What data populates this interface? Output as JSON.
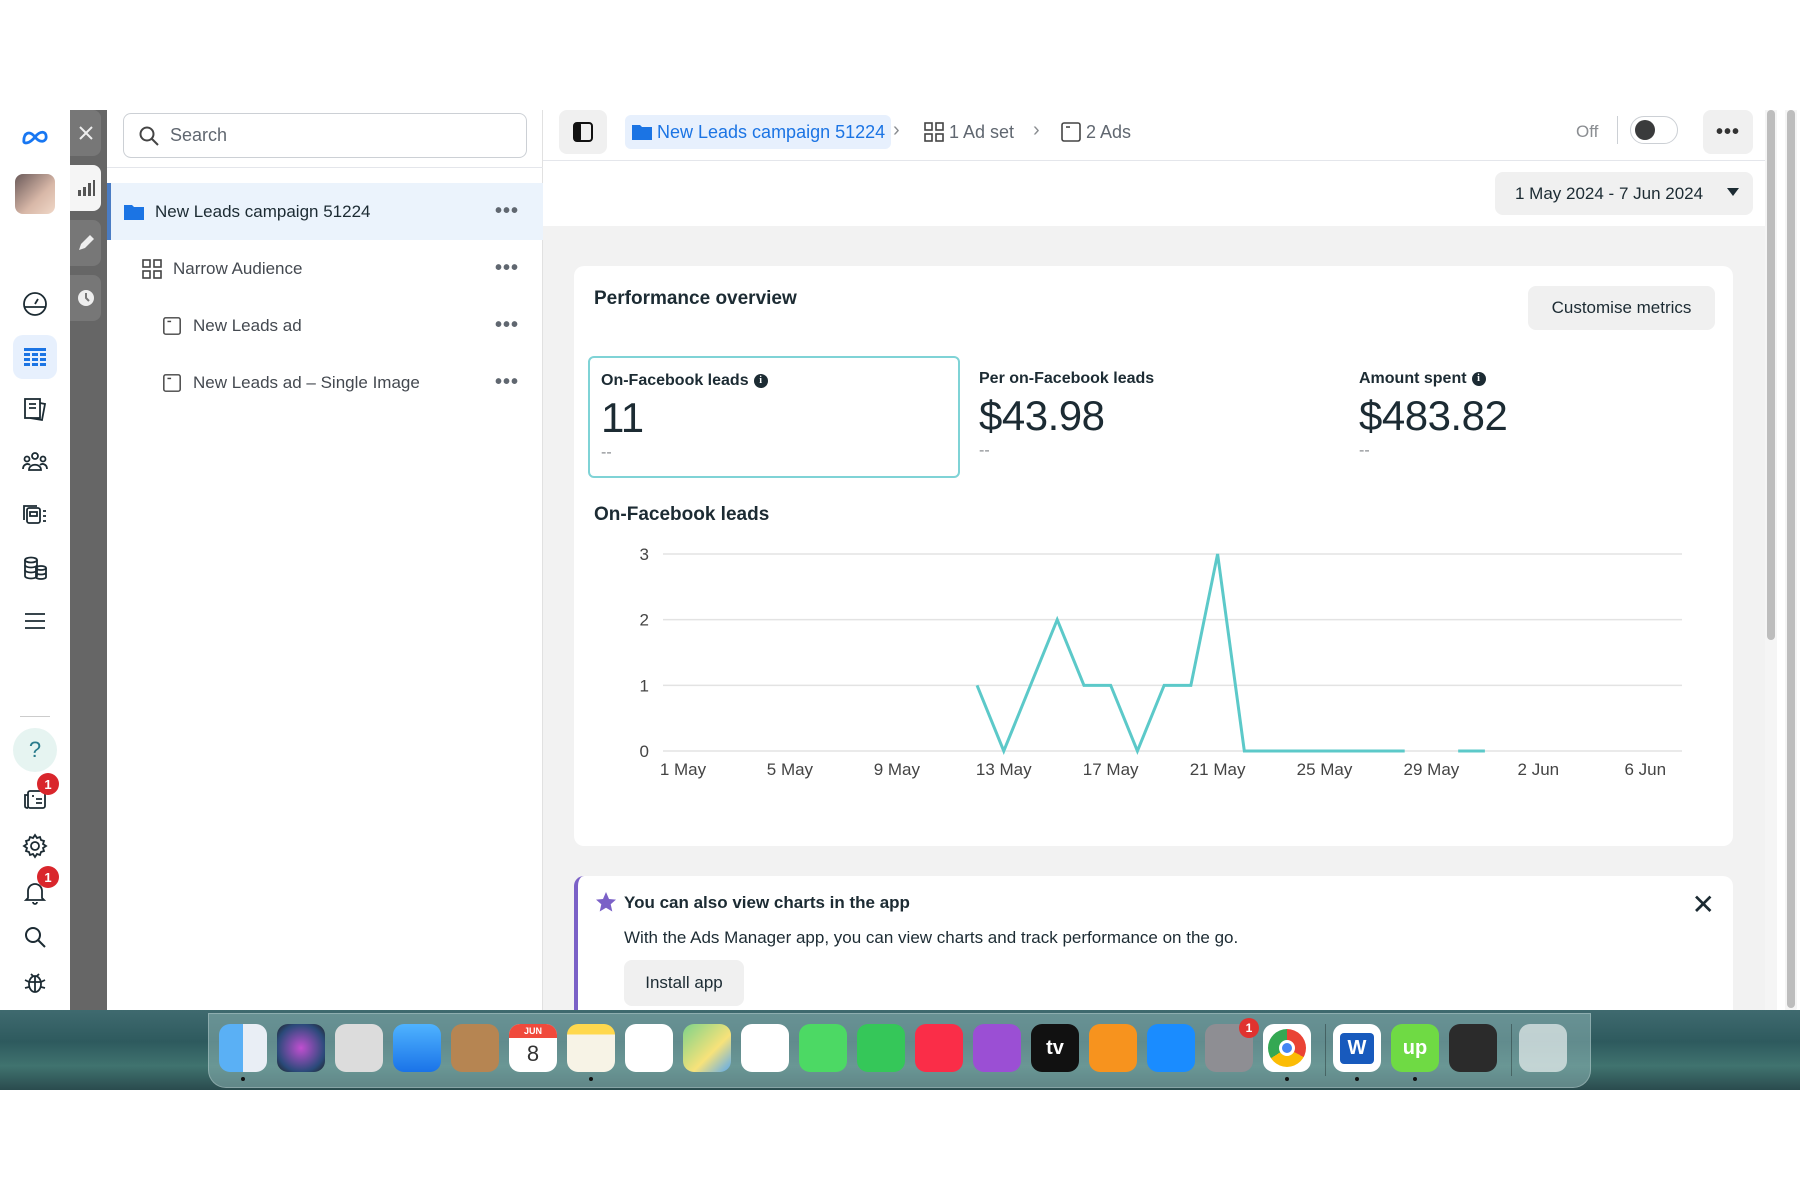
{
  "rail": {
    "icons": [
      {
        "name": "meta-logo-icon"
      },
      {
        "name": "account-avatar"
      },
      {
        "name": "dashboard-gauge-icon"
      },
      {
        "name": "ads-manager-table-icon",
        "active": true
      },
      {
        "name": "pages-icon"
      },
      {
        "name": "audiences-icon"
      },
      {
        "name": "creative-hub-icon"
      },
      {
        "name": "billing-icon"
      },
      {
        "name": "all-tools-menu-icon"
      },
      {
        "name": "help-icon"
      },
      {
        "name": "news-icon",
        "badge": "1"
      },
      {
        "name": "settings-icon"
      },
      {
        "name": "notifications-icon",
        "badge": "1"
      },
      {
        "name": "search-icon"
      },
      {
        "name": "report-bug-icon"
      }
    ]
  },
  "strip": {
    "buttons": [
      "close",
      "charts",
      "edit",
      "history"
    ]
  },
  "tree": {
    "search_placeholder": "Search",
    "rows": [
      {
        "label": "New Leads campaign 51224",
        "type": "campaign",
        "selected": true
      },
      {
        "label": "Narrow Audience",
        "type": "ad-set"
      },
      {
        "label": "New Leads ad",
        "type": "ad"
      },
      {
        "label": "New Leads ad – Single Image",
        "type": "ad"
      }
    ],
    "more_label": "•••"
  },
  "topbar": {
    "breadcrumbs": [
      {
        "label": "New Leads campaign 51224",
        "icon": "folder-icon"
      },
      {
        "label": "1 Ad set",
        "icon": "ad-set-grid-icon"
      },
      {
        "label": "2 Ads",
        "icon": "ad-icon"
      }
    ],
    "status_label": "Off",
    "toggle_on": false,
    "more_label": "•••"
  },
  "date_range": "1 May 2024 - 7 Jun 2024",
  "performance": {
    "title": "Performance overview",
    "customise_label": "Customise metrics",
    "metrics": [
      {
        "label": "On-Facebook leads",
        "value": "11",
        "comparison": "--",
        "info": true,
        "selected": true
      },
      {
        "label": "Per on-Facebook leads",
        "value": "$43.98",
        "comparison": "--",
        "info": false
      },
      {
        "label": "Amount spent",
        "value": "$483.82",
        "comparison": "--",
        "info": true
      }
    ],
    "chart_title": "On-Facebook leads"
  },
  "chart_data": {
    "type": "line",
    "title": "On-Facebook leads",
    "xlabel": "",
    "ylabel": "",
    "ylim": [
      0,
      3
    ],
    "yticks": [
      "0",
      "1",
      "2",
      "3"
    ],
    "xticks": [
      "1 May",
      "5 May",
      "9 May",
      "13 May",
      "17 May",
      "21 May",
      "25 May",
      "29 May",
      "2 Jun",
      "6 Jun"
    ],
    "x_days_start": "1 May",
    "x_days_total": 38,
    "grid": true,
    "color": "#5cc9c9",
    "series": [
      {
        "name": "On-Facebook leads",
        "segments": [
          {
            "start_day_index": 11,
            "values": [
              1,
              0,
              1,
              2,
              1,
              1,
              0,
              1,
              1,
              3,
              0,
              0,
              0,
              0,
              0,
              0,
              0
            ]
          },
          {
            "start_day_index": 29,
            "values": [
              0,
              0
            ]
          }
        ]
      }
    ]
  },
  "banner": {
    "title": "You can also view charts in the app",
    "body": "With the Ads Manager app, you can view charts and track performance on the go.",
    "button_label": "Install app",
    "close_label": "✕"
  },
  "dock": {
    "apps": [
      {
        "name": "Finder",
        "running": true
      },
      {
        "name": "Siri"
      },
      {
        "name": "Launchpad"
      },
      {
        "name": "Mail"
      },
      {
        "name": "Contacts"
      },
      {
        "name": "Calendar",
        "month": "JUN",
        "day": "8"
      },
      {
        "name": "Notes",
        "running": true
      },
      {
        "name": "Reminders"
      },
      {
        "name": "Maps"
      },
      {
        "name": "Photos"
      },
      {
        "name": "Messages"
      },
      {
        "name": "FaceTime"
      },
      {
        "name": "Music"
      },
      {
        "name": "Podcasts"
      },
      {
        "name": "Apple TV",
        "label": "tv"
      },
      {
        "name": "Books"
      },
      {
        "name": "App Store"
      },
      {
        "name": "System Settings",
        "badge": "1"
      },
      {
        "name": "Chrome",
        "running": true
      },
      {
        "name": "Word",
        "running": true,
        "label": "W"
      },
      {
        "name": "Upwork",
        "running": true,
        "label": "up"
      },
      {
        "name": "QuickTime"
      },
      {
        "name": "Trash"
      }
    ]
  }
}
